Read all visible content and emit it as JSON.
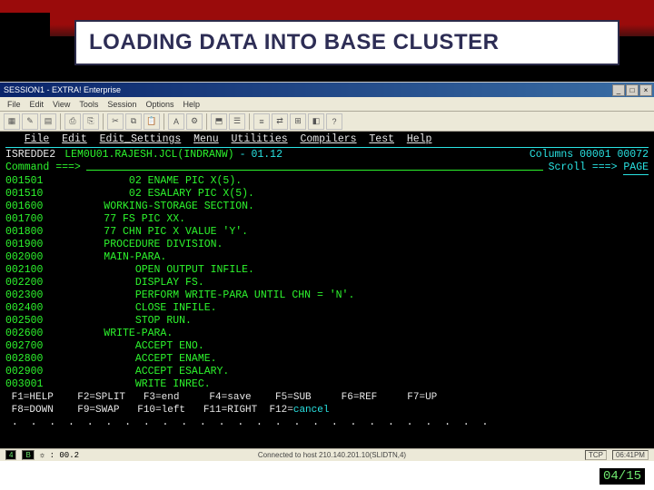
{
  "slide": {
    "title": "LOADING DATA INTO BASE CLUSTER",
    "counter": "04/15"
  },
  "window": {
    "title": "SESSION1 - EXTRA! Enterprise",
    "menubar": [
      "File",
      "Edit",
      "View",
      "Tools",
      "Session",
      "Options",
      "Help"
    ],
    "controls": {
      "min": "_",
      "max": "□",
      "close": "×"
    },
    "status_left_a": "4",
    "status_left_b": "B",
    "status_clock": "☼ : 00.2",
    "status_conn": "Connected to host 210.140.201.10(SLIDTN,4)",
    "status_right_a": "TCP",
    "status_right_b": "06:41PM"
  },
  "ispf": {
    "menu": [
      "File",
      "Edit",
      "Edit_Settings",
      "Menu",
      "Utilities",
      "Compilers",
      "Test",
      "Help"
    ],
    "program": "ISREDDE2",
    "dataset": "LEM0U01.RAJESH.JCL(INDRANW)",
    "version_sep": "-",
    "version": "01.12",
    "columns": "Columns 00001 00072",
    "command_label": "Command ===>",
    "scroll_label": "Scroll ===>",
    "scroll_value": "PAGE",
    "lines": [
      {
        "num": "001501",
        "txt": "           02 ENAME PIC X(5)."
      },
      {
        "num": "001510",
        "txt": "           02 ESALARY PIC X(5)."
      },
      {
        "num": "001600",
        "txt": "       WORKING-STORAGE SECTION."
      },
      {
        "num": "001700",
        "txt": "       77 FS PIC XX."
      },
      {
        "num": "001800",
        "txt": "       77 CHN PIC X VALUE 'Y'."
      },
      {
        "num": "001900",
        "txt": "       PROCEDURE DIVISION."
      },
      {
        "num": "002000",
        "txt": "       MAIN-PARA."
      },
      {
        "num": "002100",
        "txt": "            OPEN OUTPUT INFILE."
      },
      {
        "num": "002200",
        "txt": "            DISPLAY FS."
      },
      {
        "num": "002300",
        "txt": "            PERFORM WRITE-PARA UNTIL CHN = 'N'."
      },
      {
        "num": "002400",
        "txt": "            CLOSE INFILE."
      },
      {
        "num": "002500",
        "txt": "            STOP RUN."
      },
      {
        "num": "002600",
        "txt": "       WRITE-PARA."
      },
      {
        "num": "002700",
        "txt": "            ACCEPT ENO."
      },
      {
        "num": "002800",
        "txt": "            ACCEPT ENAME."
      },
      {
        "num": "002900",
        "txt": "            ACCEPT ESALARY."
      },
      {
        "num": "003001",
        "txt": "            WRITE INREC."
      }
    ],
    "fkeys1": " F1=HELP    F2=SPLIT   F3=end     F4=save    F5=SUB     F6=REF     F7=UP",
    "fkeys2": " F8=DOWN    F9=SWAP   F10=left   F11=RIGHT  F12=",
    "fkeys2_cancel": "cancel",
    "dots": " .  .  .  .  .  .  .  .  .  .  .  .  .  .  .  .  .  .  .  .  .  .  .  .  .  ."
  }
}
